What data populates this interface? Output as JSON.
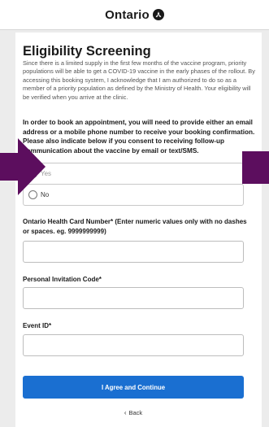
{
  "header": {
    "brand": "Ontario",
    "logo_icon": "trillium-logo-icon"
  },
  "page": {
    "title": "Eligibility Screening",
    "intro": "Since there is a limited supply in the first few months of the vaccine program, priority populations will be able to get a COVID-19 vaccine in the early phases of the rollout. By accessing this booking system, I acknowledge that I am authorized to do so as a member of a priority population as defined by the Ministry of Health. Your eligibility will be verified when you arrive at the clinic.",
    "consent_prompt": "In order to book an appointment, you will need to provide either an email address or a mobile phone number to receive your booking confirmation. Please also indicate below if you consent to receiving follow-up communication about the vaccine by email or text/SMS."
  },
  "consent_options": [
    {
      "label": "Yes"
    },
    {
      "label": "No"
    }
  ],
  "fields": {
    "health_card": {
      "label": "Ontario Health Card Number* (Enter numeric values only with no dashes or spaces. eg. 9999999999)",
      "value": ""
    },
    "invitation_code": {
      "label": "Personal Invitation Code*",
      "value": ""
    },
    "event_id": {
      "label": "Event ID*",
      "value": ""
    }
  },
  "actions": {
    "submit_label": "I Agree and Continue",
    "back_label": "Back"
  },
  "colors": {
    "primary": "#1a6fd1",
    "annotation_arrow": "#5c0e5e"
  }
}
